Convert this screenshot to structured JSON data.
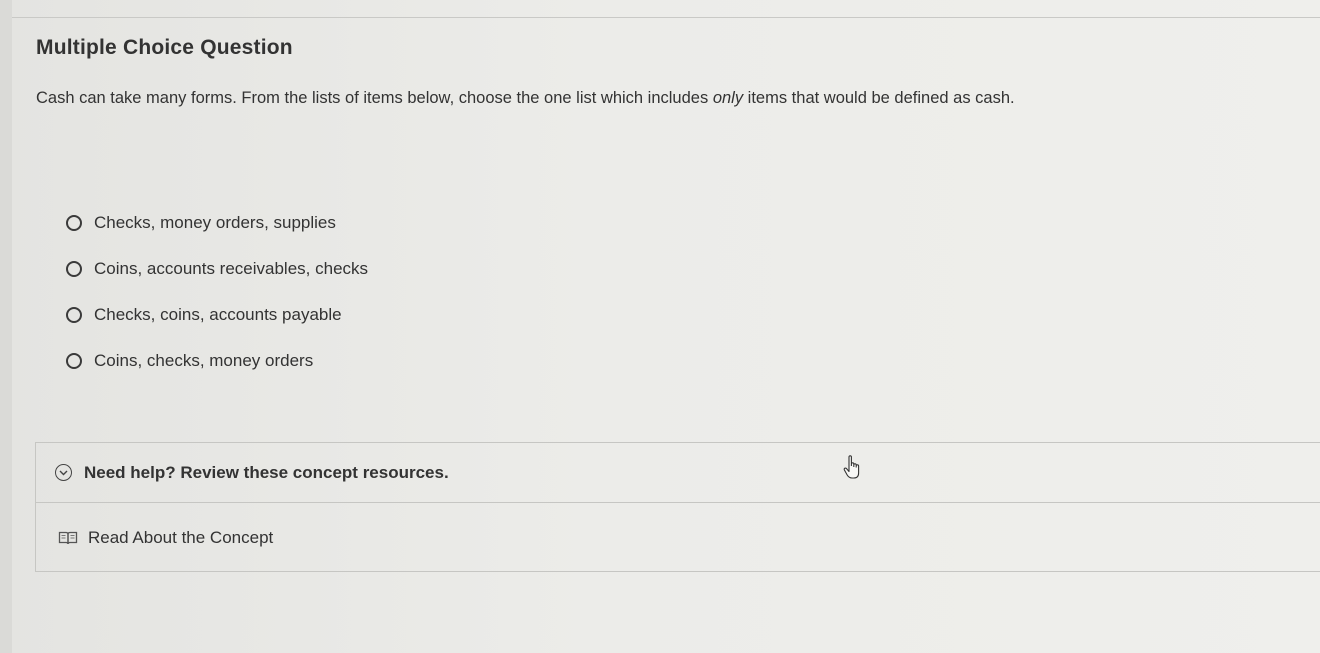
{
  "question": {
    "title": "Multiple Choice Question",
    "prompt_before": "Cash can take many forms. From the lists of items below, choose the one list which includes ",
    "prompt_emphasis": "only",
    "prompt_after": " items that would be defined as cash.",
    "options": [
      {
        "label": "Checks, money orders, supplies"
      },
      {
        "label": "Coins, accounts receivables, checks"
      },
      {
        "label": "Checks, coins, accounts payable"
      },
      {
        "label": "Coins, checks, money orders"
      }
    ]
  },
  "help": {
    "title": "Need help? Review these concept resources.",
    "link_label": "Read About the Concept",
    "icons": {
      "toggle": "chevron-down-circle-icon",
      "resource": "book-icon",
      "cursor": "hand-pointer-icon"
    }
  }
}
